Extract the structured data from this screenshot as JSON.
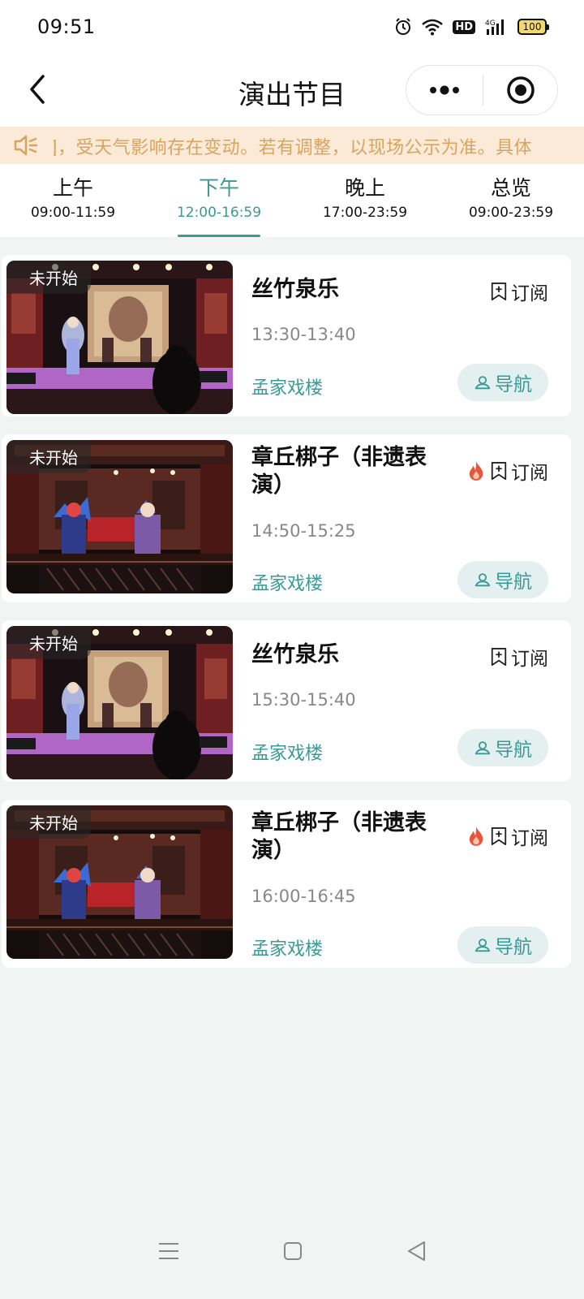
{
  "status_bar": {
    "time": "09:51",
    "battery": "100",
    "network": "4G",
    "hd": "HD"
  },
  "nav": {
    "title": "演出节目"
  },
  "notice": {
    "text": "]，受天气影响存在变动。若有调整，以现场公示为准。具体"
  },
  "tabs": [
    {
      "name": "上午",
      "time": "09:00-11:59",
      "active": false
    },
    {
      "name": "下午",
      "time": "12:00-16:59",
      "active": true
    },
    {
      "name": "晚上",
      "time": "17:00-23:59",
      "active": false
    },
    {
      "name": "总览",
      "time": "09:00-23:59",
      "active": false
    }
  ],
  "cards": [
    {
      "status": "未开始",
      "title": "丝竹泉乐",
      "time": "13:30-13:40",
      "venue": "孟家戏楼",
      "subscribe": "订阅",
      "navigate": "导航",
      "hot": false,
      "image": "stage-music"
    },
    {
      "status": "未开始",
      "title": "章丘梆子（非遗表演）",
      "time": "14:50-15:25",
      "venue": "孟家戏楼",
      "subscribe": "订阅",
      "navigate": "导航",
      "hot": true,
      "image": "stage-opera"
    },
    {
      "status": "未开始",
      "title": "丝竹泉乐",
      "time": "15:30-15:40",
      "venue": "孟家戏楼",
      "subscribe": "订阅",
      "navigate": "导航",
      "hot": false,
      "image": "stage-music"
    },
    {
      "status": "未开始",
      "title": "章丘梆子（非遗表演）",
      "time": "16:00-16:45",
      "venue": "孟家戏楼",
      "subscribe": "订阅",
      "navigate": "导航",
      "hot": true,
      "image": "stage-opera"
    }
  ],
  "colors": {
    "accent": "#3a9a96",
    "notice_bg": "#fbead7",
    "notice_text": "#d9a45e",
    "hot": "#e8553d"
  },
  "icons": {
    "back": "chevron-left-icon",
    "more": "more-dots-icon",
    "close": "target-circle-icon",
    "notice": "speaker-icon",
    "subscribe": "bookmark-plus-icon",
    "hot": "flame-icon",
    "navigate": "location-person-icon"
  }
}
